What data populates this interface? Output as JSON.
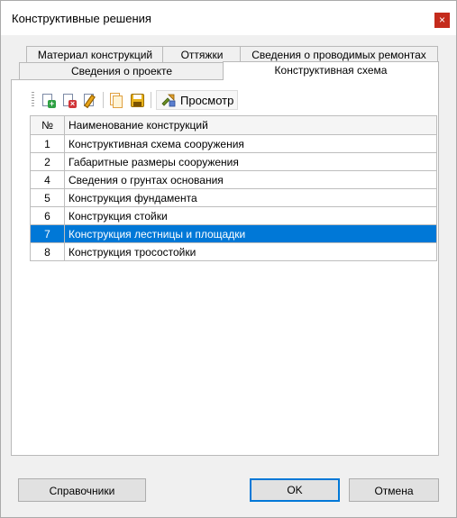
{
  "window": {
    "title": "Конструктивные решения",
    "close_label": "×"
  },
  "tabs": {
    "row1": [
      {
        "label": "Материал конструкций"
      },
      {
        "label": "Оттяжки"
      },
      {
        "label": "Сведения о проводимых ремонтах"
      }
    ],
    "row2": [
      {
        "label": "Сведения о проекте"
      },
      {
        "label": "Конструктивная схема",
        "active": true
      }
    ]
  },
  "toolbar": {
    "icons": [
      "add-document-icon",
      "delete-document-icon",
      "edit-document-icon",
      "copy-document-icon",
      "save-icon",
      "preview-icon"
    ],
    "view_label": "Просмотр"
  },
  "table": {
    "columns": [
      "№",
      "Наименование конструкций"
    ],
    "rows": [
      {
        "num": "1",
        "name": "Конструктивная схема сооружения"
      },
      {
        "num": "2",
        "name": "Габаритные размеры сооружения"
      },
      {
        "num": "4",
        "name": "Сведения о грунтах основания"
      },
      {
        "num": "5",
        "name": "Конструкция фундамента"
      },
      {
        "num": "6",
        "name": "Конструкция стойки"
      },
      {
        "num": "7",
        "name": "Конструкция лестницы и площадки",
        "selected": true
      },
      {
        "num": "8",
        "name": "Конструкция тросостойки"
      }
    ]
  },
  "buttons": {
    "reference": "Справочники",
    "ok": "OK",
    "cancel": "Отмена"
  },
  "colors": {
    "selection": "#0078d7",
    "close": "#c42b1c"
  }
}
